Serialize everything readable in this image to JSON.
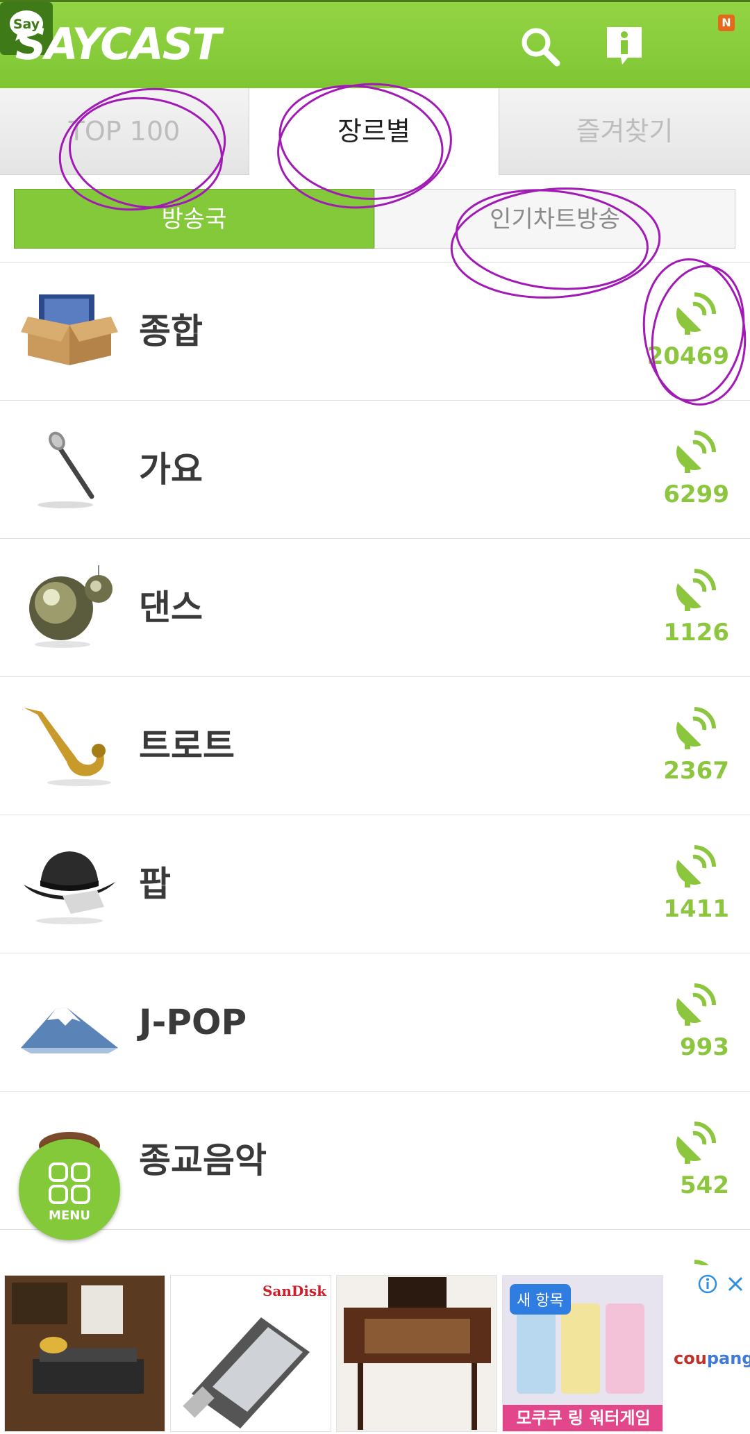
{
  "header": {
    "logo": "SAYCAST",
    "icons": [
      "search-icon",
      "info-icon",
      "say-icon"
    ],
    "say_label": "Say",
    "say_badge": "N",
    "brand_color": "#84c93a"
  },
  "tabs": [
    {
      "label": "TOP 100",
      "active": false
    },
    {
      "label": "장르별",
      "active": true
    },
    {
      "label": "즐겨찾기",
      "active": false
    }
  ],
  "subtabs": [
    {
      "label": "방송국",
      "active": true
    },
    {
      "label": "인기차트방송",
      "active": false
    }
  ],
  "genres": [
    {
      "name": "종합",
      "count": "20469",
      "icon": "boxed-records-icon"
    },
    {
      "name": "가요",
      "count": "6299",
      "icon": "microphone-icon"
    },
    {
      "name": "댄스",
      "count": "1126",
      "icon": "disco-ball-icon"
    },
    {
      "name": "트로트",
      "count": "2367",
      "icon": "saxophone-icon"
    },
    {
      "name": "팝",
      "count": "1411",
      "icon": "fedora-hat-icon"
    },
    {
      "name": "J-POP",
      "count": "993",
      "icon": "mount-fuji-icon"
    },
    {
      "name": "종교음악",
      "count": "542",
      "icon": "religion-icon"
    }
  ],
  "menu": {
    "label": "MENU"
  },
  "ad": {
    "sandisk_logo": "SanDisk",
    "new_badge": "새 항목",
    "caption": "모쿠쿠 링 워터게임",
    "brand_a": "cou",
    "brand_b": "pang"
  }
}
